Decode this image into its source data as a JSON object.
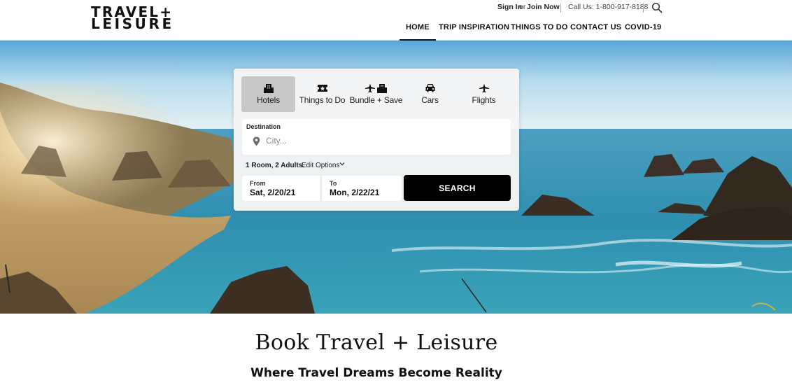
{
  "brand": {
    "logo_line1": "TRAVEL+",
    "logo_line2": "LEISURE"
  },
  "utility": {
    "sign_in": "Sign In",
    "or": "or",
    "join_now": "Join Now",
    "call": "Call Us: 1-800-917-8188",
    "search_icon": "search-icon"
  },
  "nav": {
    "items": [
      {
        "label": "HOME",
        "active": true
      },
      {
        "label": "TRIP INSPIRATION",
        "active": false
      },
      {
        "label": "THINGS TO DO",
        "active": false
      },
      {
        "label": "CONTACT US",
        "active": false
      },
      {
        "label": "COVID-19",
        "active": false
      }
    ]
  },
  "booking": {
    "tabs": [
      {
        "label": "Hotels",
        "icon": "hotel-icon",
        "active": true
      },
      {
        "label": "Things to Do",
        "icon": "ticket-icon",
        "active": false
      },
      {
        "label": "Bundle + Save",
        "icon": "plane-hotel-icon",
        "active": false
      },
      {
        "label": "Cars",
        "icon": "car-icon",
        "active": false
      },
      {
        "label": "Flights",
        "icon": "plane-icon",
        "active": false
      }
    ],
    "destination_label": "Destination",
    "destination_placeholder": "City...",
    "destination_value": "",
    "rooms_summary": "1 Room, 2 Adults.",
    "edit_options": "Edit Options",
    "from_label": "From",
    "from_value": "Sat, 2/20/21",
    "to_label": "To",
    "to_value": "Mon, 2/22/21",
    "search_button": "SEARCH"
  },
  "main": {
    "title": "Book Travel + Leisure",
    "subtitle": "Where Travel Dreams Become Reality"
  },
  "colors": {
    "sea": "#2f8fb0",
    "sky": "#a9d4ee",
    "sand": "#c9a56b",
    "button": "#000000",
    "tab_active": "#c7c7c7"
  }
}
